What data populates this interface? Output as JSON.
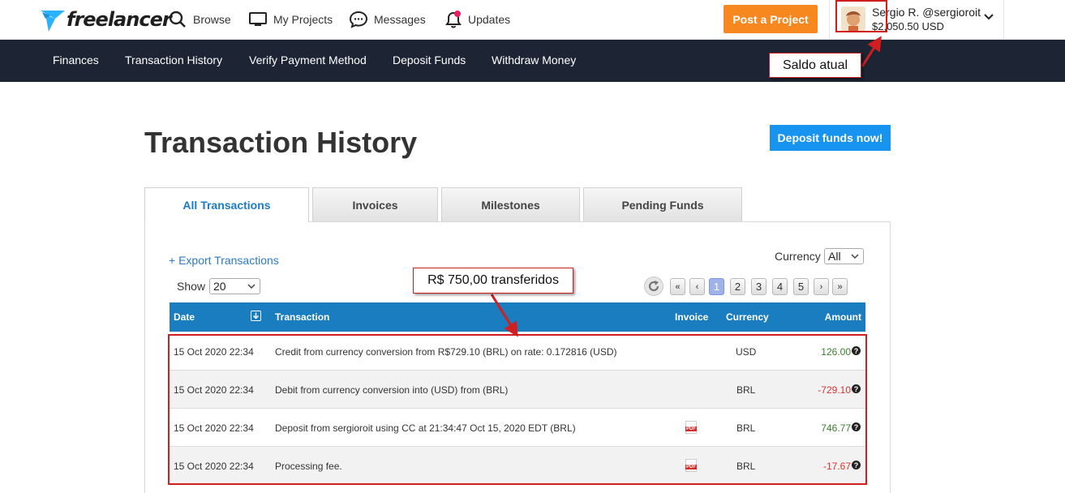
{
  "header": {
    "logo_text": "freelancer",
    "nav": [
      {
        "label": "Browse",
        "icon": "search-icon"
      },
      {
        "label": "My Projects",
        "icon": "monitor-icon"
      },
      {
        "label": "Messages",
        "icon": "chat-icon"
      },
      {
        "label": "Updates",
        "icon": "bell-icon"
      }
    ],
    "post_button": "Post a Project",
    "user": {
      "name": "Sergio R. @sergioroit",
      "balance": "$2,050.50 USD"
    }
  },
  "subnav": [
    "Finances",
    "Transaction History",
    "Verify Payment Method",
    "Deposit Funds",
    "Withdraw Money"
  ],
  "annotations": {
    "balance_callout": "Saldo atual",
    "transfer_callout": "R$ 750,00 transferidos"
  },
  "page": {
    "title": "Transaction History",
    "deposit_button": "Deposit funds now!"
  },
  "tabs": [
    "All Transactions",
    "Invoices",
    "Milestones",
    "Pending Funds"
  ],
  "controls": {
    "export_link": "+ Export Transactions",
    "currency_label": "Currency",
    "currency_value": "All",
    "show_label": "Show",
    "show_value": "20"
  },
  "pagination": {
    "first": "«",
    "prev": "‹",
    "next": "›",
    "last": "»",
    "pages": [
      "1",
      "2",
      "3",
      "4",
      "5"
    ],
    "current": "1"
  },
  "table": {
    "columns": {
      "date": "Date",
      "transaction": "Transaction",
      "invoice": "Invoice",
      "currency": "Currency",
      "amount": "Amount"
    },
    "rows": [
      {
        "date": "15 Oct 2020 22:34",
        "transaction": "Credit from currency conversion from R$729.10 (BRL) on rate: 0.172816 (USD)",
        "invoice": false,
        "currency": "USD",
        "amount": "126.00",
        "sign": "pos"
      },
      {
        "date": "15 Oct 2020 22:34",
        "transaction": "Debit from currency conversion into (USD) from (BRL)",
        "invoice": false,
        "currency": "BRL",
        "amount": "-729.10",
        "sign": "neg"
      },
      {
        "date": "15 Oct 2020 22:34",
        "transaction": "Deposit from sergioroit using CC at 21:34:47 Oct 15, 2020 EDT (BRL)",
        "invoice": true,
        "currency": "BRL",
        "amount": "746.77",
        "sign": "pos"
      },
      {
        "date": "15 Oct 2020 22:34",
        "transaction": "Processing fee.",
        "invoice": true,
        "currency": "BRL",
        "amount": "-17.67",
        "sign": "neg"
      }
    ]
  },
  "colors": {
    "accent_orange": "#f7871f",
    "accent_blue": "#1794f0",
    "table_header": "#1a7dbf",
    "subnav_bg": "#1d2433",
    "highlight_red": "#d11e1e",
    "positive": "#3b7d2c",
    "negative": "#d9332f"
  }
}
